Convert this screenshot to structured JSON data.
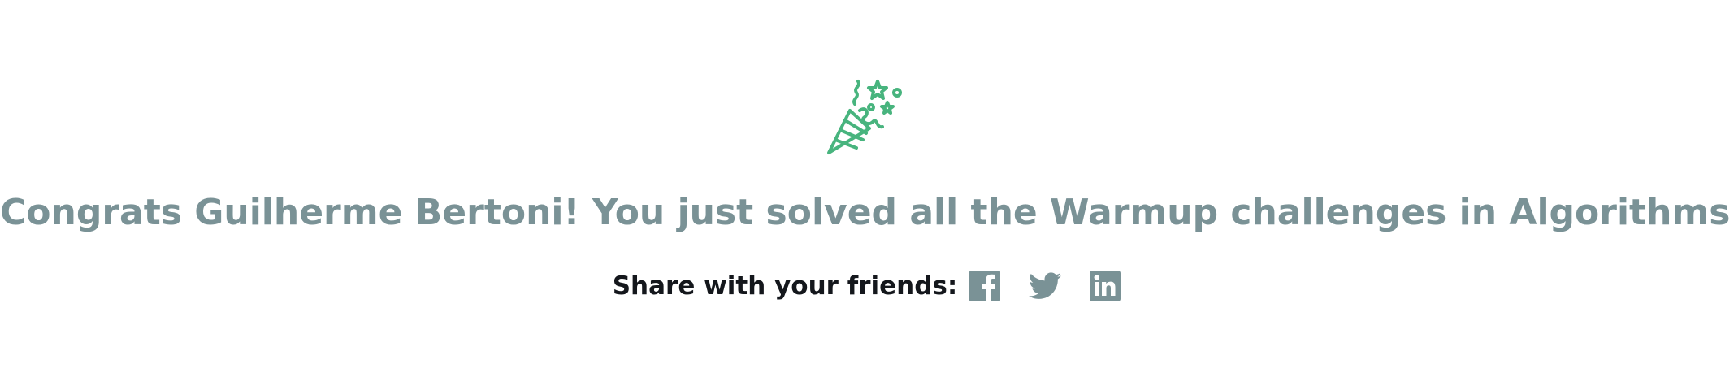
{
  "congrats": {
    "message": "Congrats Guilherme Bertoni! You just solved all the Warmup challenges in Algorithms!",
    "icon": "party-popper-icon",
    "icon_color": "#48b47e",
    "message_color": "#7a9296"
  },
  "share": {
    "label": "Share with your friends:",
    "label_color": "#14171c",
    "icon_color": "#7a9296",
    "networks": [
      {
        "name": "facebook",
        "icon": "facebook-icon"
      },
      {
        "name": "twitter",
        "icon": "twitter-icon"
      },
      {
        "name": "linkedin",
        "icon": "linkedin-icon"
      }
    ]
  }
}
